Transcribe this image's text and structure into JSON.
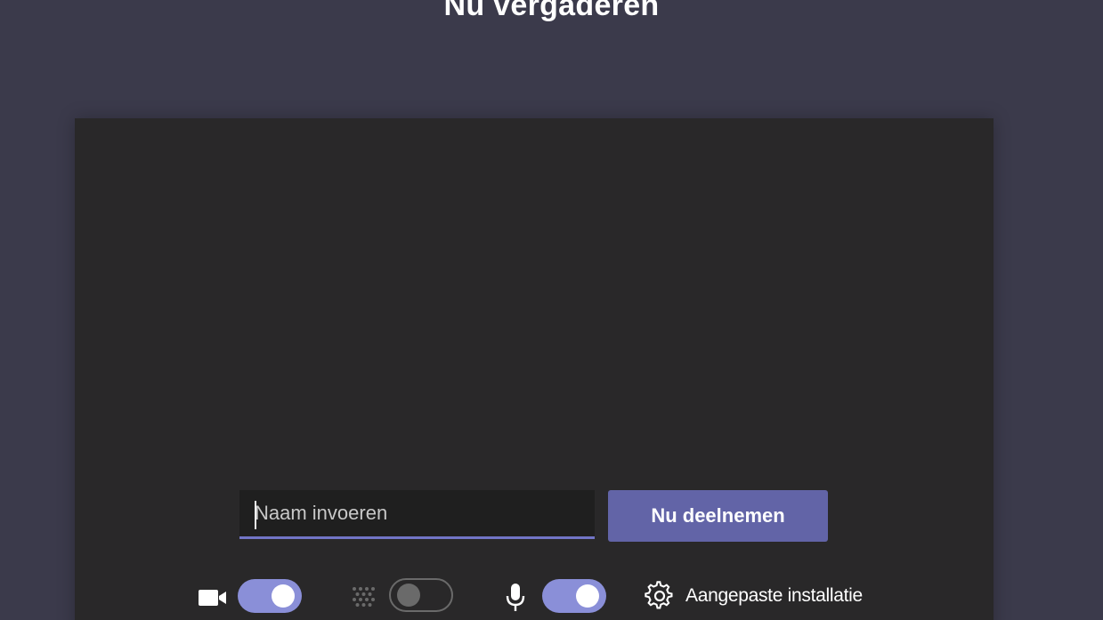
{
  "header": {
    "title": "Nu vergaderen"
  },
  "join_form": {
    "name_placeholder": "Naam invoeren",
    "name_value": "",
    "join_button_label": "Nu deelnemen"
  },
  "controls": {
    "camera": {
      "icon": "camera-icon",
      "enabled": true
    },
    "background_blur": {
      "icon": "background-blur-icon",
      "enabled": false
    },
    "microphone": {
      "icon": "microphone-icon",
      "enabled": true
    },
    "settings": {
      "icon": "gear-icon",
      "label": "Aangepaste installatie"
    }
  },
  "colors": {
    "page_background": "#3b3a4b",
    "preview_background": "#292829",
    "accent": "#6264a7",
    "toggle_on": "#8a8fd8"
  }
}
